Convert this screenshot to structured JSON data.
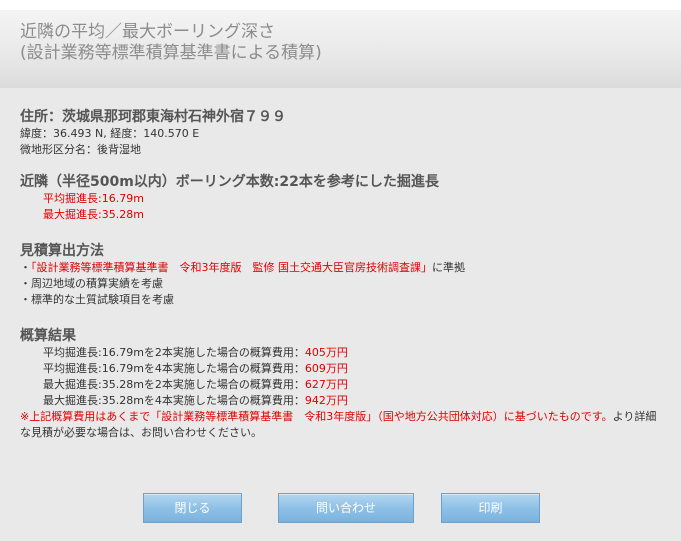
{
  "header": {
    "title_line1": "近隣の平均／最大ボーリング深さ",
    "title_line2": "(設計業務等標準積算基準書による積算)"
  },
  "location": {
    "address": "住所：茨城県那珂郡東海村石神外宿７９９",
    "coords": "緯度：36.493 N, 経度：140.570 E",
    "landform": "微地形区分名：後背湿地"
  },
  "nearby": {
    "title": "近隣（半径500m以内）ボーリング本数:22本を参考にした掘進長",
    "avg": "平均掘進長:16.79m",
    "max": "最大掘進長:35.28m"
  },
  "method": {
    "title": "見積算出方法",
    "items": [
      "・「設計業務等標準積算基準書　令和3年度版　監修 国土交通大臣官房技術調査課」に準拠",
      "・周辺地域の積算実績を考慮",
      "・標準的な土質試験項目を考慮"
    ]
  },
  "results": {
    "title": "概算結果",
    "rows": [
      {
        "label": "平均掘進長:16.79mを2本実施した場合の概算費用：",
        "cost": "405万円"
      },
      {
        "label": "平均掘進長:16.79mを4本実施した場合の概算費用：",
        "cost": "609万円"
      },
      {
        "label": "最大掘進長:35.28mを2本実施した場合の概算費用：",
        "cost": "627万円"
      },
      {
        "label": "最大掘進長:35.28mを4本実施した場合の概算費用：",
        "cost": "942万円"
      }
    ],
    "note_line1": "※上記概算費用はあくまで「設計業務等標準積算基準書　令和3年度版」（国や地方公共団体対応）に基づいたものです。より詳細な見積が必要な場合は、お問い合わせください。"
  },
  "buttons": {
    "close": "閉じる",
    "contact": "問い合わせ",
    "print": "印刷"
  }
}
